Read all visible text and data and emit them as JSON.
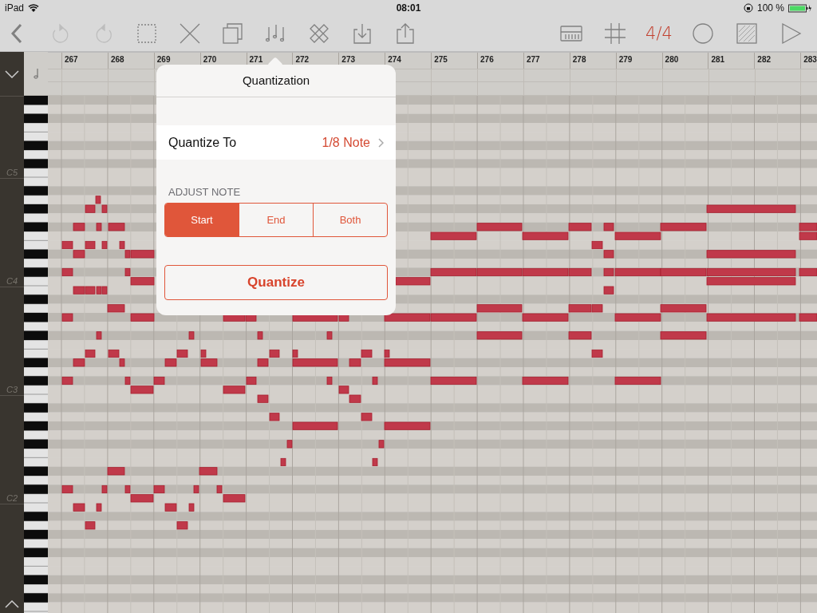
{
  "status_bar": {
    "device": "iPad",
    "time": "08:01",
    "battery": "100 %"
  },
  "toolbar": {
    "left": [
      {
        "kind": "back",
        "disabled": false
      },
      {
        "kind": "undo",
        "disabled": true
      },
      {
        "kind": "redo",
        "disabled": true
      },
      {
        "kind": "select",
        "disabled": false
      },
      {
        "kind": "delete",
        "disabled": false
      },
      {
        "kind": "duplicate",
        "disabled": false
      },
      {
        "kind": "quantize",
        "disabled": false
      },
      {
        "kind": "edit",
        "disabled": false
      },
      {
        "kind": "import",
        "disabled": false
      },
      {
        "kind": "share",
        "disabled": false
      }
    ],
    "right": [
      {
        "kind": "keyboard",
        "disabled": false
      },
      {
        "kind": "grid",
        "disabled": false
      },
      {
        "kind": "time_signature",
        "label": "4/4",
        "disabled": false
      },
      {
        "kind": "record",
        "disabled": false
      },
      {
        "kind": "region",
        "disabled": false
      },
      {
        "kind": "play",
        "disabled": false
      }
    ]
  },
  "ruler": {
    "measures": [
      "267",
      "268",
      "269",
      "270",
      "271",
      "272",
      "273",
      "274",
      "275",
      "276",
      "277",
      "278",
      "279",
      "280",
      "281",
      "282",
      "283"
    ]
  },
  "octave_labels": [
    "C5",
    "C4",
    "C3",
    "C2"
  ],
  "popover": {
    "title": "Quantization",
    "quantize_to": {
      "label": "Quantize To",
      "value": "1/8 Note"
    },
    "section": "ADJUST NOTE",
    "segments": [
      {
        "label": "Start",
        "selected": true
      },
      {
        "label": "End",
        "selected": false
      },
      {
        "label": "Both",
        "selected": false
      }
    ],
    "button": "Quantize"
  }
}
